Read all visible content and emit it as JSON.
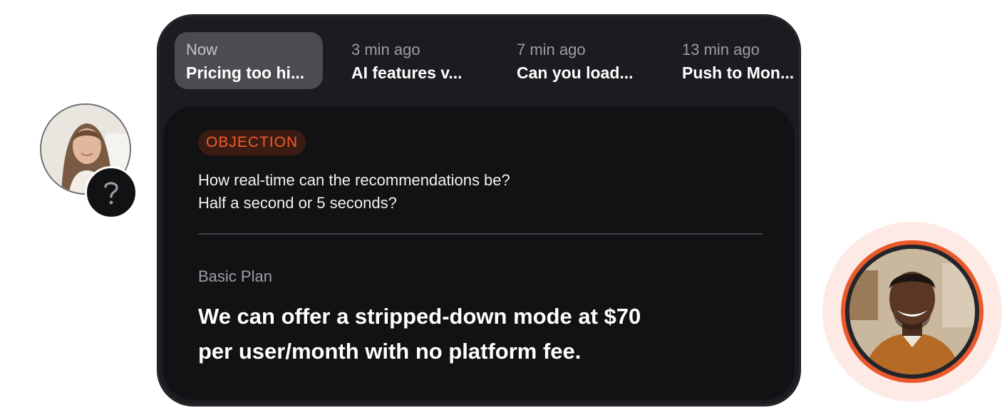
{
  "tabs": [
    {
      "time": "Now",
      "title": "Pricing too hi..."
    },
    {
      "time": "3 min ago",
      "title": "AI features v..."
    },
    {
      "time": "7 min ago",
      "title": "Can you load..."
    },
    {
      "time": "13 min ago",
      "title": "Push to Mon..."
    }
  ],
  "card": {
    "badge": "OBJECTION",
    "question_line1": "How real-time can the recommendations be?",
    "question_line2": "Half a second or 5 seconds?",
    "plan_label": "Basic Plan",
    "answer_line1": "We can offer a stripped-down mode at $70",
    "answer_line2": "per user/month with no platform fee."
  },
  "participants": {
    "left_badge_icon": "question-mark-icon",
    "accent_color": "#e85a2c"
  }
}
